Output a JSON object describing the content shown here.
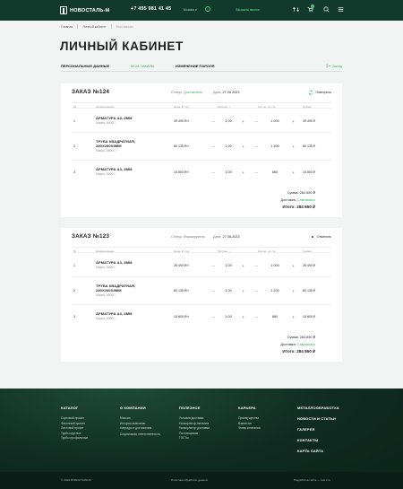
{
  "header": {
    "brand": "НОВОСТАЛЬ-М",
    "phone": "+7 495 981 41 45",
    "mode": "Москва ∨",
    "callback": "Заказать звонок"
  },
  "breadcrumbs": [
    "Главная",
    "Личный кабинет",
    "Мои заказы"
  ],
  "page_title": "ЛИЧНЫЙ КАБИНЕТ",
  "tabs": {
    "personal": "ПЕРСОНАЛЬНЫЕ ДАННЫЕ",
    "orders": "МОИ ЗАКАЗЫ",
    "password": "ИЗМЕНЕНИЕ ПАРОЛЯ",
    "logout": "Выход"
  },
  "table_headers": {
    "num": "№",
    "name": "Наименование",
    "price": "Цена, ₽ / ед.",
    "qty": "Метраж, т",
    "count": "Кол-во, шт / м",
    "sum": "Сумма"
  },
  "orders": [
    {
      "title": "ЗАКАЗ №124",
      "status_label": "Статус:",
      "status": "Доставлено",
      "date_label": "Дата:",
      "date": "27.06.2023",
      "action": "Повторить",
      "items": [
        {
          "idx": "1",
          "name": "АРМАТУРА А3, 8ММ",
          "sub": "Марка: А500С",
          "price": "39 490 ₽/т",
          "qty": "1,00",
          "count": "1 000",
          "sum": "39 490 ₽"
        },
        {
          "idx": "2",
          "name": "ТРУБА КВАДРАТНАЯ, 280Х280Х8ММ",
          "sub": "Марка: А500С",
          "price": "80 135 ₽/т",
          "qty": "1,00",
          "count": "1 200",
          "sum": "80 135 ₽"
        },
        {
          "idx": "3",
          "name": "АРМАТУРА А3, 8ММ",
          "sub": "Марка: А500С",
          "price": "15 800 ₽/т",
          "qty": "1,00",
          "count": "860",
          "sum": "15 800 ₽"
        }
      ],
      "sum_label": "Сумма:",
      "sum_value": "284 850 ₽",
      "delivery_label": "Доставка:",
      "delivery_value": "Самовывоз",
      "total_label": "Итого:",
      "total_value": "284 850 ₽"
    },
    {
      "title": "ЗАКАЗ №123",
      "status_label": "Статус:",
      "status": "Формируется",
      "date_label": "Дата:",
      "date": "27.06.2023",
      "action": "Отменить",
      "items": [
        {
          "idx": "1",
          "name": "АРМАТУРА А3, 8ММ",
          "sub": "Марка: А500С",
          "price": "39 490 ₽/т",
          "qty": "1,00",
          "count": "1 000",
          "sum": "39 490 ₽"
        },
        {
          "idx": "2",
          "name": "ТРУБА КВАДРАТНАЯ, 280Х280Х8ММ",
          "sub": "Марка: А500С",
          "price": "80 135 ₽/т",
          "qty": "1,00",
          "count": "1 200",
          "sum": "80 135 ₽"
        },
        {
          "idx": "3",
          "name": "АРМАТУРА А3, 8ММ",
          "sub": "Марка: А500С",
          "price": "15 800 ₽/т",
          "qty": "1,00",
          "count": "860",
          "sum": "15 800 ₽"
        }
      ],
      "sum_label": "Сумма:",
      "sum_value": "284 850 ₽",
      "delivery_label": "Доставка:",
      "delivery_value": "Самовывоз",
      "total_label": "Итого:",
      "total_value": "284 850 ₽"
    }
  ],
  "footer": {
    "catalog": {
      "title": "КАТАЛОГ",
      "links": [
        "Сортовой прокат",
        "Фасонный прокат",
        "Листовой прокат",
        "Трубы круглые",
        "Трубы профильные"
      ]
    },
    "company": {
      "title": "О КОМПАНИИ",
      "links": [
        "Миссия",
        "История компании",
        "Награды и достижения",
        "Социальная ответственность"
      ]
    },
    "useful": {
      "title": "ПОЛЕЗНОЕ",
      "links": [
        "Условия доставки",
        "Калькулятор металла",
        "Калькулятор доставки",
        "Поставщикам",
        "ГОСТы"
      ]
    },
    "career": {
      "title": "КАРЬЕРА",
      "links": [
        "Преимущества",
        "Вакансии",
        "Фомы компании"
      ]
    },
    "right": [
      "МЕТАЛЛООБРАБОТКА",
      "НОВОСТИ И СТАТЬИ",
      "ГАЛЕРЕЯ",
      "КОНТАКТЫ",
      "КАРТА САЙТА"
    ],
    "copyright": "© 2023 НОВОСТАЛЬ-М",
    "policy": "Политика обработки данных",
    "dev": "Разработка сайта — lets.c.ru"
  }
}
